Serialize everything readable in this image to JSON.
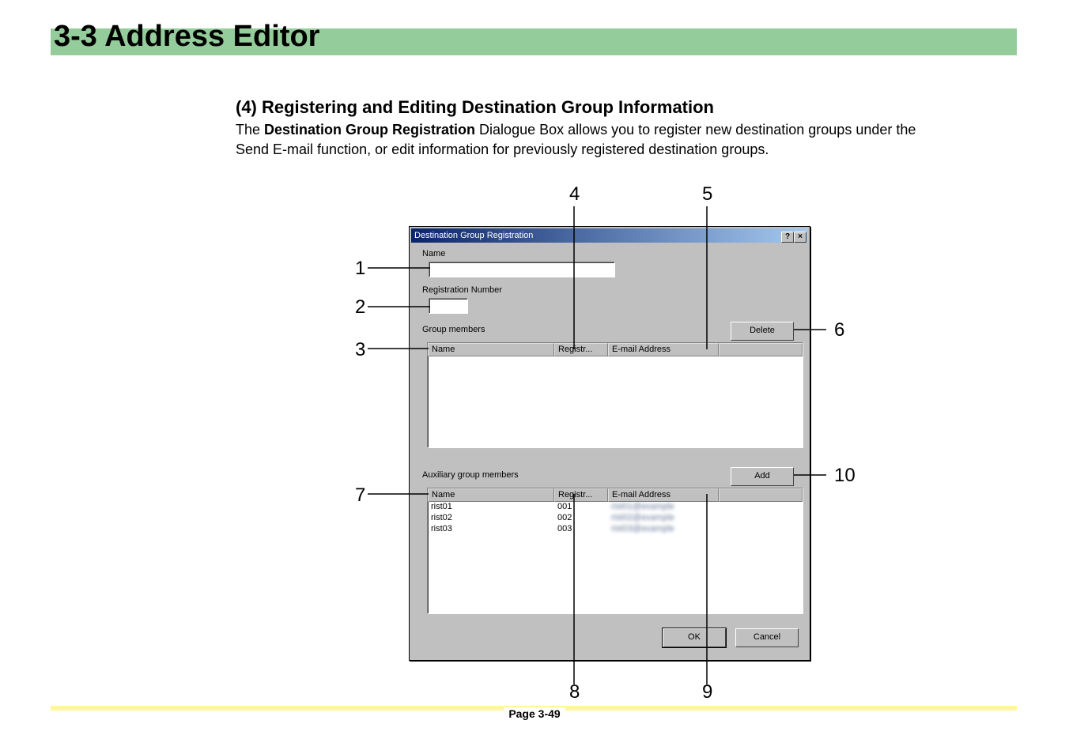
{
  "section": {
    "title": "3-3  Address Editor"
  },
  "heading": "(4) Registering and Editing Destination Group Information",
  "para_pre": "The ",
  "para_bold": "Destination Group Registration",
  "para_post": " Dialogue Box allows you to register new destination groups under the Send E-mail function, or edit information for previously registered destination groups.",
  "dialog": {
    "title": "Destination Group Registration",
    "help_glyph": "?",
    "close_glyph": "×",
    "labels": {
      "name": "Name",
      "regnum": "Registration Number",
      "group_members": "Group members",
      "aux_members": "Auxiliary group members"
    },
    "buttons": {
      "delete": "Delete",
      "add": "Add",
      "ok": "OK",
      "cancel": "Cancel"
    },
    "columns": {
      "name": "Name",
      "registr": "Registr...",
      "email": "E-mail Address"
    },
    "aux_rows": [
      {
        "name": "rist01",
        "registr": "001",
        "email": "rist01@example"
      },
      {
        "name": "rist02",
        "registr": "002",
        "email": "rist02@example"
      },
      {
        "name": "rist03",
        "registr": "003",
        "email": "rist03@example"
      }
    ]
  },
  "callouts": {
    "n1": "1",
    "n2": "2",
    "n3": "3",
    "n4": "4",
    "n5": "5",
    "n6": "6",
    "n7": "7",
    "n8": "8",
    "n9": "9",
    "n10": "10"
  },
  "footer": {
    "page": "Page 3-49"
  }
}
